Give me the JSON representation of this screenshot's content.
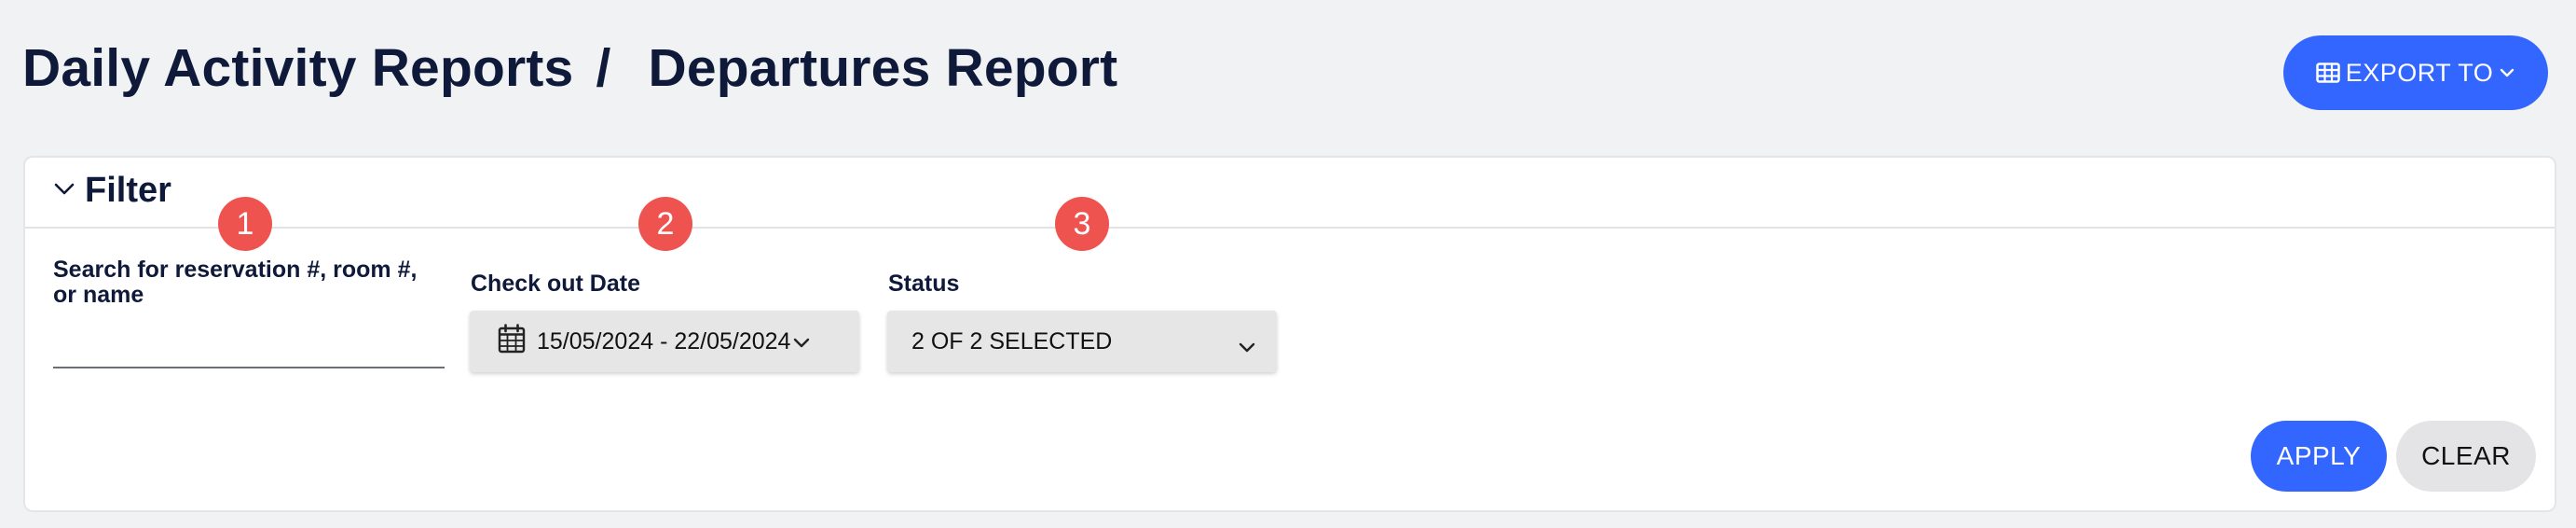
{
  "breadcrumb": {
    "parent": "Daily Activity Reports",
    "separator": "/",
    "current": "Departures Report"
  },
  "export": {
    "label": "EXPORT TO",
    "icon": "table-icon",
    "caret_icon": "chevron-down-icon"
  },
  "filter": {
    "title": "Filter",
    "toggle_icon": "chevron-down-icon",
    "badges": [
      "1",
      "2",
      "3"
    ],
    "search": {
      "label_line1": "Search for reservation #, room #,",
      "label_line2": "or name",
      "value": "",
      "placeholder": ""
    },
    "checkout": {
      "label": "Check out Date",
      "value": "15/05/2024 - 22/05/2024",
      "icon": "calendar-icon"
    },
    "status": {
      "label": "Status",
      "value": "2 OF 2 SELECTED"
    },
    "apply_label": "APPLY",
    "clear_label": "CLEAR"
  },
  "colors": {
    "accent": "#3366ff",
    "badge": "#ef5350",
    "page_bg": "#f1f2f4",
    "text": "#0f1a3a"
  }
}
